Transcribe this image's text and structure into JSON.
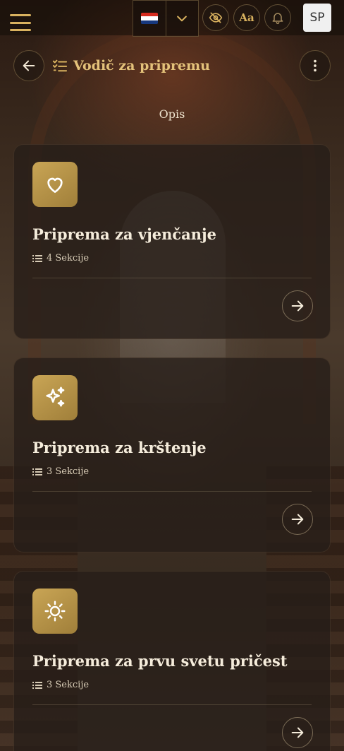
{
  "header": {
    "menu_icon": "hamburger-icon",
    "language_flag": "croatia-flag",
    "language_toggle_icon": "chevron-down-icon",
    "visibility_icon": "eye-off-icon",
    "font_size_label": "Aa",
    "notifications_icon": "bell-icon",
    "avatar_initials": "SP"
  },
  "page": {
    "title": "Vodič za pripremu",
    "title_icon": "checklist-icon",
    "back_icon": "arrow-left-icon",
    "more_icon": "more-vertical-icon",
    "subtitle": "Opis"
  },
  "guides": [
    {
      "title": "Priprema za vjenčanje",
      "icon": "heart-icon",
      "sections": "4 Sekcije"
    },
    {
      "title": "Priprema za krštenje",
      "icon": "sparkles-icon",
      "sections": "3 Sekcije"
    },
    {
      "title": "Priprema za prvu svetu pričest",
      "icon": "sun-icon",
      "sections": "3 Sekcije"
    }
  ],
  "colors": {
    "accent_gold": "#d9b25f",
    "card_bg": "#261e18",
    "icon_tile": "#b8943f"
  }
}
